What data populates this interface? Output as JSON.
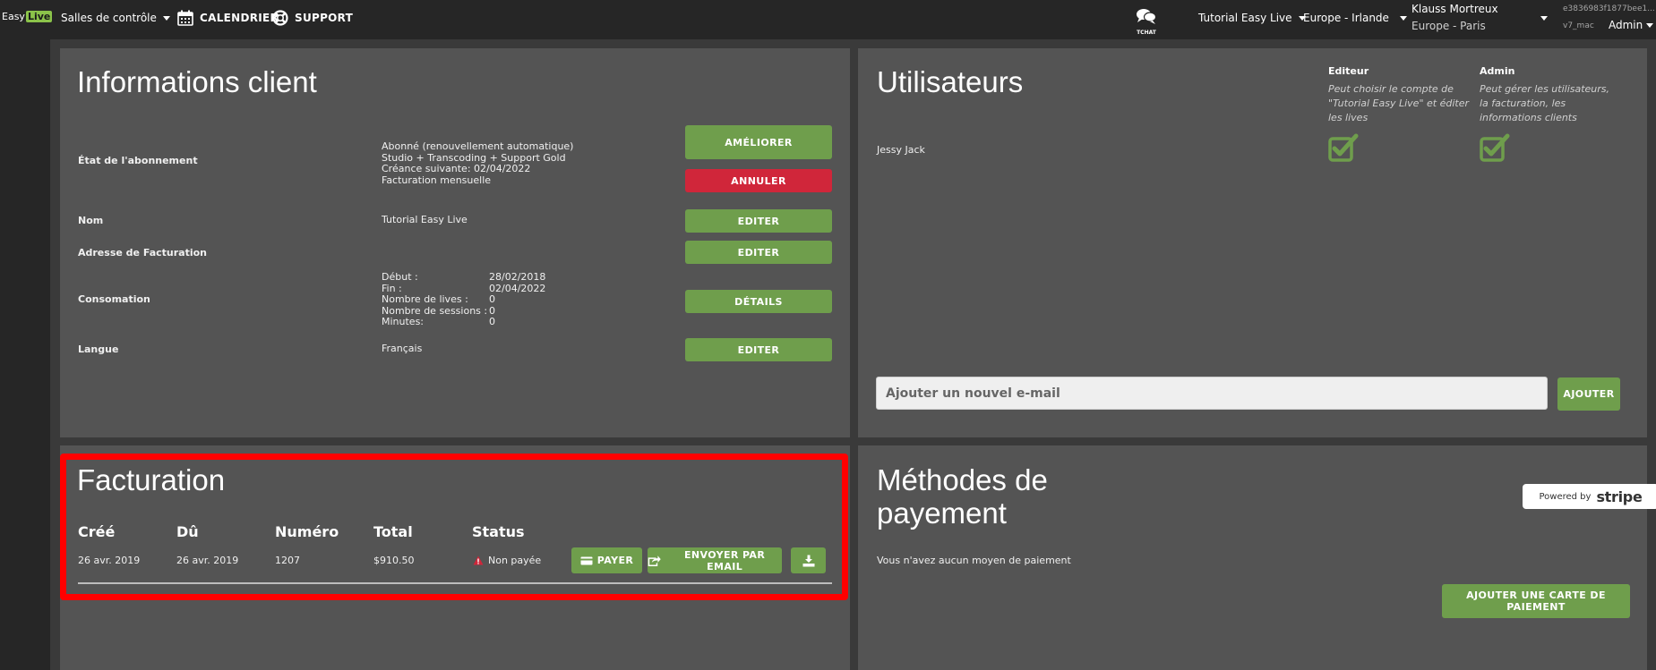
{
  "topbar": {
    "logo_easy": "Easy",
    "logo_live": "Live",
    "salles": "Salles de contrôle",
    "calendrier": "CALENDRIER",
    "support": "SUPPORT",
    "tchat": "TCHAT",
    "account": "Tutorial Easy Live",
    "region": "Europe - Irlande",
    "user_name": "Klauss Mortreux",
    "user_zone": "Europe - Paris",
    "session_id": "e3836983f1877bee1...",
    "version": "v7_mac",
    "role": "Admin"
  },
  "info": {
    "title": "Informations client",
    "abonnement_label": "État de l'abonnement",
    "abonnement_lines": [
      "Abonné (renouvellement automatique)",
      "Studio + Transcoding + Support Gold",
      "Créance suivante: 02/04/2022",
      "Facturation mensuelle"
    ],
    "ameliorer": "AMÉLIORER",
    "annuler": "ANNULER",
    "nom_label": "Nom",
    "nom_value": "Tutorial Easy Live",
    "editer": "EDITER",
    "adresse_label": "Adresse de Facturation",
    "consommation_label": "Consomation",
    "conso_rows": [
      {
        "k": "Début :",
        "v": "28/02/2018"
      },
      {
        "k": "Fin :",
        "v": "02/04/2022"
      },
      {
        "k": "Nombre de lives :",
        "v": "0"
      },
      {
        "k": "Nombre de sessions :",
        "v": "0"
      },
      {
        "k": "Minutes:",
        "v": "0"
      }
    ],
    "details": "DÉTAILS",
    "langue_label": "Langue",
    "langue_value": "Français"
  },
  "users": {
    "title": "Utilisateurs",
    "editeur_head": "Editeur",
    "editeur_desc": "Peut choisir le compte de \"Tutorial Easy Live\" et éditer les lives",
    "admin_head": "Admin",
    "admin_desc": "Peut gérer les utilisateurs, la facturation, les informations clients",
    "user_name": "Jessy Jack",
    "email_placeholder": "Ajouter un nouvel e-mail",
    "ajouter": "AJOUTER"
  },
  "billing": {
    "title": "Facturation",
    "headers": [
      "Créé",
      "Dû",
      "Numéro",
      "Total",
      "Status"
    ],
    "row": {
      "cree": "26 avr. 2019",
      "du": "26 avr. 2019",
      "numero": "1207",
      "total": "$910.50",
      "status": "Non payée"
    },
    "payer": "PAYER",
    "email": "ENVOYER PAR EMAIL"
  },
  "payment": {
    "title_line1": "Méthodes de",
    "title_line2": "payement",
    "powered": "Powered by",
    "stripe": "stripe",
    "empty": "Vous n'avez aucun moyen de paiement",
    "add_card": "AJOUTER UNE CARTE DE PAIEMENT"
  },
  "colors": {
    "accent_green": "#6f9e4c",
    "danger_red": "#d0263a",
    "highlight": "#ff0000"
  }
}
